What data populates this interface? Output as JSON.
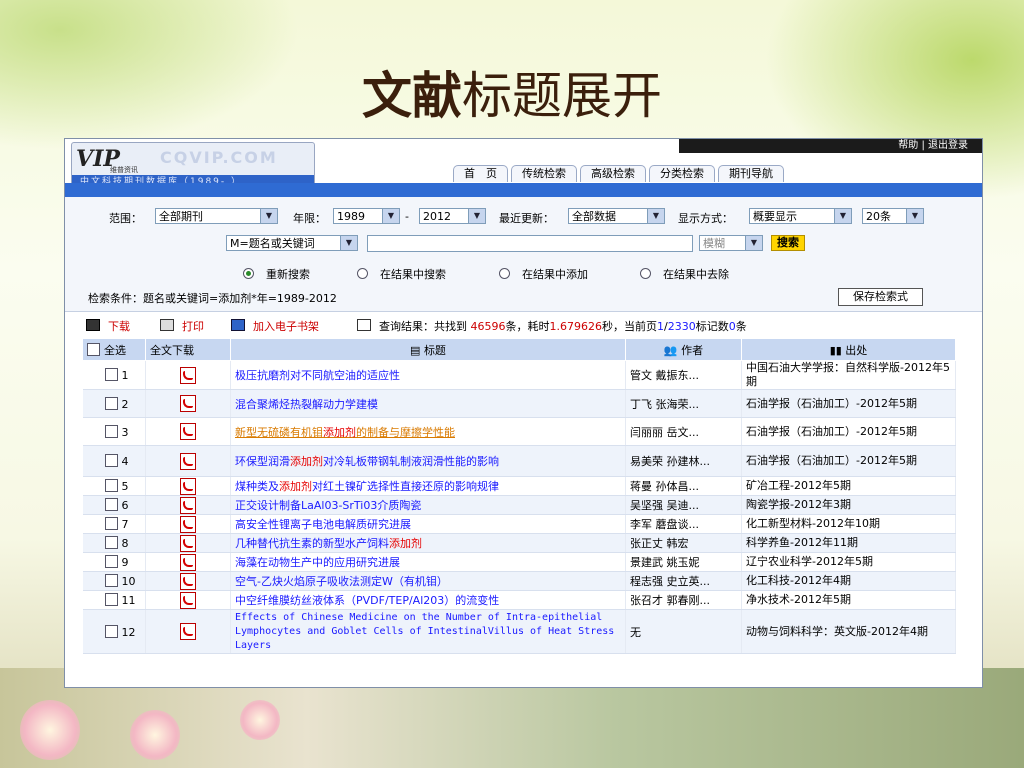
{
  "slide": {
    "title_bold": "文献",
    "title_rest": "标题展开"
  },
  "header": {
    "top_links": "帮助 | 退出登录",
    "logo_vip": "VIP",
    "logo_sub": "维普资讯",
    "logo_cqvip": "CQVIP.COM",
    "logo_strip": "中文科技期刊数据库（1989- ）",
    "tabs": [
      "首　页",
      "传统检索",
      "高级检索",
      "分类检索",
      "期刊导航"
    ]
  },
  "search": {
    "scope_label": "范围：",
    "scope_value": "全部期刊",
    "year_label": "年限：",
    "year_from": "1989",
    "year_dash": "-",
    "year_to": "2012",
    "update_label": "最近更新：",
    "update_value": "全部数据",
    "display_label": "显示方式：",
    "display_value": "概要显示",
    "count_value": "20条",
    "field_value": "M=题名或关键词",
    "query_value": "",
    "mode_value": "模糊",
    "search_button": "搜索",
    "radios": [
      "重新搜索",
      "在结果中搜索",
      "在结果中添加",
      "在结果中去除"
    ],
    "condition": "检索条件：题名或关键词=添加剂*年=1989-2012",
    "save_button": "保存检索式"
  },
  "toolbar": {
    "download": "下载",
    "print": "打印",
    "add_ebook": "加入电子书架",
    "result_prefix": "查询结果：共找到",
    "total": "46596",
    "unit1": "条，耗时",
    "time": "1.679626",
    "unit2": "秒，当前页",
    "page": "1",
    "slash": "/",
    "pages": "2330",
    "marked_prefix": "标记数",
    "marked": "0",
    "unit3": "条"
  },
  "table": {
    "headers": {
      "select_all": "全选",
      "download": "全文下载",
      "title": "标题",
      "author": "作者",
      "source": "出处"
    },
    "rows": [
      {
        "n": "1",
        "pre": "极压抗磨剂对不同航空油的适应性",
        "hl": "",
        "post": "",
        "author": "管文 戴振东...",
        "source": "中国石油大学学报：自然科学版-2012年5期"
      },
      {
        "n": "2",
        "pre": "混合聚烯烃热裂解动力学建模",
        "hl": "",
        "post": "",
        "author": "丁飞 张海荣...",
        "source": "石油学报（石油加工）-2012年5期"
      },
      {
        "n": "3",
        "pre": "新型无硫磷有机钼",
        "hl": "添加剂",
        "post": "的制备与摩擦学性能",
        "author": "闫丽丽 岳文...",
        "source": "石油学报（石油加工）-2012年5期",
        "visited": true
      },
      {
        "n": "4",
        "pre": "环保型润滑",
        "hl": "添加剂",
        "post": "对冷轧板带钢轧制液润滑性能的影响",
        "author": "易美荣 孙建林...",
        "source": "石油学报（石油加工）-2012年5期"
      },
      {
        "n": "5",
        "pre": "煤种类及",
        "hl": "添加剂",
        "post": "对红土镍矿选择性直接还原的影响规律",
        "author": "蒋曼 孙体昌...",
        "source": "矿冶工程-2012年5期"
      },
      {
        "n": "6",
        "pre": "正交设计制备LaAl03-SrTi03介质陶瓷",
        "hl": "",
        "post": "",
        "author": "吴坚强 吴迪...",
        "source": "陶瓷学报-2012年3期"
      },
      {
        "n": "7",
        "pre": "高安全性锂离子电池电解质研究进展",
        "hl": "",
        "post": "",
        "author": "李军 蘑盘谈...",
        "source": "化工新型材料-2012年10期"
      },
      {
        "n": "8",
        "pre": "几种替代抗生素的新型水产饲料",
        "hl": "添加剂",
        "post": "",
        "author": "张正丈 韩宏",
        "source": "科学养鱼-2012年11期"
      },
      {
        "n": "9",
        "pre": "海藻在动物生产中的应用研究进展",
        "hl": "",
        "post": "",
        "author": "景建武 姚玉妮",
        "source": "辽宁农业科学-2012年5期"
      },
      {
        "n": "10",
        "pre": "空气-乙炔火焰原子吸收法测定W（有机钼）",
        "hl": "",
        "post": "",
        "author": "程志强 史立英...",
        "source": "化工科技-2012年4期"
      },
      {
        "n": "11",
        "pre": "中空纤维膜纺丝液体系（PVDF/TEP/Al203）的流变性",
        "hl": "",
        "post": "",
        "author": "张召才 郭春刚...",
        "source": "净水技术-2012年5期"
      },
      {
        "n": "12",
        "pre": "Effects of Chinese Medicine on the Number of Intra-epithelial Lymphocytes and Goblet Cells of IntestinalVillus of Heat Stress Layers",
        "hl": "",
        "post": "",
        "author": "无",
        "source": "动物与饲料科学：英文版-2012年4期",
        "english": true
      }
    ]
  }
}
